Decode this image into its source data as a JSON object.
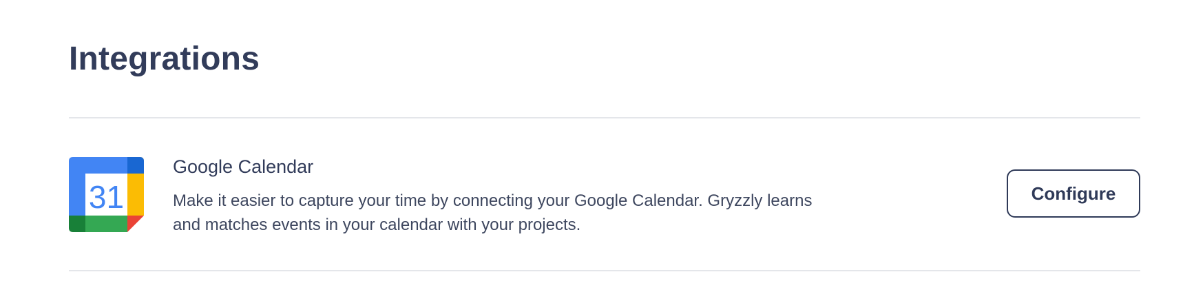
{
  "page": {
    "title": "Integrations"
  },
  "integrations": [
    {
      "icon": "google-calendar-icon",
      "icon_day": "31",
      "name": "Google Calendar",
      "description": "Make it easier to capture your time by connecting your Google Calendar. Gryzzly learns and matches events in your calendar with your projects.",
      "action_label": "Configure"
    }
  ],
  "colors": {
    "text_primary": "#323c5a",
    "divider": "#e4e6ea",
    "gcal_blue": "#4285f4",
    "gcal_yellow": "#fbbc04",
    "gcal_green": "#34a853",
    "gcal_dark_green": "#188038",
    "gcal_red": "#ea4335",
    "gcal_dark_blue": "#1967d2"
  }
}
